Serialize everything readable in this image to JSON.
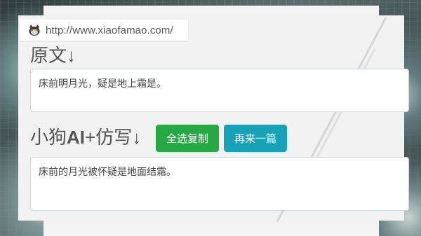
{
  "address_bar": {
    "url": "http://www.xiaofamao.com/",
    "icon": "cat-icon"
  },
  "original": {
    "heading": "原文↓",
    "text": "床前明月光，疑是地上霜是。"
  },
  "rewrite": {
    "heading_prefix": "小狗",
    "heading_bold": "AI",
    "heading_suffix": "+仿写↓",
    "text": "床前的月光被怀疑是地面结霜。"
  },
  "buttons": {
    "copy_all": "全选复制",
    "another": "再来一篇"
  },
  "colors": {
    "copy_button": "#28a745",
    "another_button": "#17a2b8",
    "heading_text": "#555555"
  }
}
